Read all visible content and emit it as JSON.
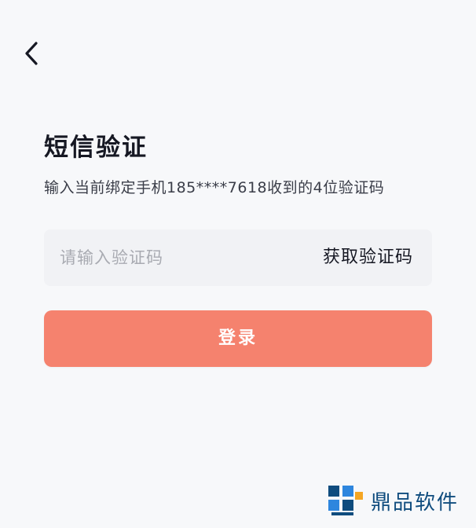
{
  "header": {
    "back_icon": "chevron-left-icon"
  },
  "verify": {
    "title": "短信验证",
    "subtitle": "输入当前绑定手机185****7618收到的4位验证码"
  },
  "code_field": {
    "value": "",
    "placeholder": "请输入验证码",
    "get_code_label": "获取验证码"
  },
  "login": {
    "label": "登录",
    "color": "#f5826e"
  },
  "watermark": {
    "icon": "brand-logo-icon",
    "text": "鼎品软件",
    "color": "#0f4c7e"
  }
}
